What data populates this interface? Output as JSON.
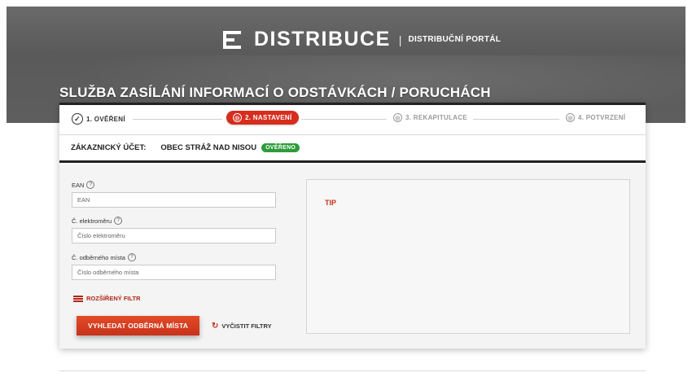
{
  "header": {
    "brand_name": "DISTRIBUCE",
    "separator": "|",
    "portal_name": "DISTRIBUČNÍ PORTÁL",
    "page_title": "SLUŽBA ZASÍLÁNÍ INFORMACÍ O ODSTÁVKÁCH / PORUCHÁCH"
  },
  "steps": [
    {
      "label": "1. OVĚŘENÍ",
      "state": "done",
      "icon": "check-circle-icon",
      "glyph": "✓"
    },
    {
      "label": "2. NASTAVENÍ",
      "state": "active",
      "icon": "target-icon",
      "glyph": "◎"
    },
    {
      "label": "3. REKAPITULACE",
      "state": "pending",
      "icon": "target-icon",
      "glyph": "◎"
    },
    {
      "label": "4. POTVRZENÍ",
      "state": "pending",
      "icon": "target-icon",
      "glyph": "◎"
    }
  ],
  "account": {
    "label": "ZÁKAZNICKÝ ÚČET:",
    "name": "OBEC STRÁŽ NAD NISOU",
    "status": "OVĚŘENO",
    "status_color": "#2c9c3a"
  },
  "form": {
    "ean": {
      "label": "EAN",
      "placeholder": "EAN"
    },
    "meter": {
      "label": "Č. elektroměru",
      "placeholder": "Číslo elektroměru"
    },
    "place": {
      "label": "Č. odběrného místa",
      "placeholder": "Číslo odběrného místa"
    },
    "help_glyph": "?",
    "advanced_filter": "ROZŠÍŘENÝ FILTR",
    "search_button": "VYHLEDAT ODBĚRNÁ MÍSTA",
    "clear_filters": "VYČISTIT FILTRY",
    "clear_glyph": "↻"
  },
  "tip": {
    "title": "TIP"
  },
  "colors": {
    "accent": "#d62d1e",
    "dark": "#222222"
  }
}
